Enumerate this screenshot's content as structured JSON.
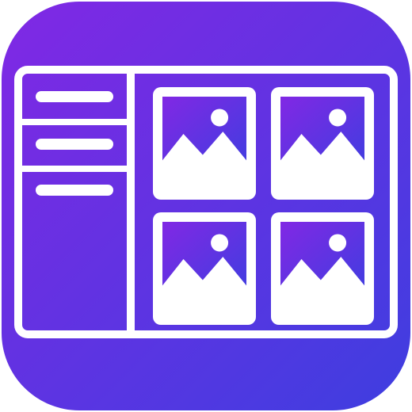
{
  "icon": {
    "name": "gallery-layout-app-icon",
    "gradient_start": "#8128e4",
    "gradient_end": "#3e3ee0",
    "stroke_color": "#ffffff"
  },
  "sidebar": {
    "menu_items": [
      {
        "icon": "menu-line"
      },
      {
        "icon": "menu-line"
      },
      {
        "icon": "menu-line"
      }
    ]
  },
  "gallery": {
    "tiles": [
      {
        "icon": "image-placeholder-icon"
      },
      {
        "icon": "image-placeholder-icon"
      },
      {
        "icon": "image-placeholder-icon"
      },
      {
        "icon": "image-placeholder-icon"
      }
    ]
  }
}
